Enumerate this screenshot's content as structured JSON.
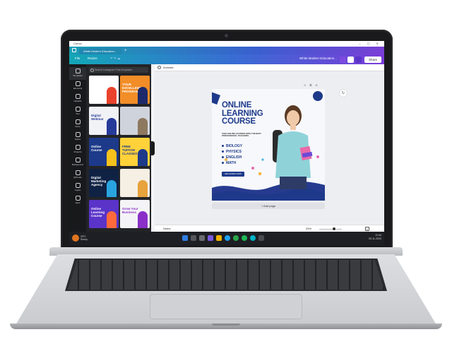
{
  "window": {
    "title": "Canva"
  },
  "tabs": [
    {
      "label": "White Modern Education..."
    }
  ],
  "header": {
    "file_label": "File",
    "resize_label": "Resize",
    "doc_title": "White Modern Education...",
    "share_label": "Share",
    "collaborators": "4"
  },
  "rail": [
    {
      "label": "Templates"
    },
    {
      "label": "Elements"
    },
    {
      "label": "Uploads"
    },
    {
      "label": "Text"
    },
    {
      "label": "Draw"
    },
    {
      "label": "Styles"
    },
    {
      "label": "Projects"
    },
    {
      "label": "Background"
    },
    {
      "label": "QRCode"
    },
    {
      "label": "Logos"
    },
    {
      "label": "Apps"
    }
  ],
  "panel": {
    "search_placeholder": "Search Instagram Post templates",
    "templates": [
      {
        "text": "",
        "bg": "#ffffff",
        "fg": "#1d3a8a",
        "accent": "#e9432c"
      },
      {
        "text": "YOUR EXCELLENT PROGRAM",
        "bg": "#f28d27",
        "fg": "#ffffff",
        "accent": "#1c2a6b"
      },
      {
        "text": "Digital Webinar",
        "bg": "#f1f2f6",
        "fg": "#263a9a",
        "accent": "#263a9a"
      },
      {
        "text": "",
        "bg": "#cfd3dc",
        "fg": "#333333",
        "accent": "#8e7860"
      },
      {
        "text": "Online Course",
        "bg": "#1d3a8a",
        "fg": "#ffffff",
        "accent": "#f7c21c"
      },
      {
        "text": "FREE TUITION CLASSES",
        "bg": "#ffd23a",
        "fg": "#1d3a8a",
        "accent": "#1d3a8a"
      },
      {
        "text": "Digital Marketing Agency",
        "bg": "#0f2244",
        "fg": "#ffffff",
        "accent": "#2aa4e0"
      },
      {
        "text": "",
        "bg": "#f5efe4",
        "fg": "#333333",
        "accent": "#e7a33c"
      },
      {
        "text": "Online Learning Course",
        "bg": "#5a33c9",
        "fg": "#ffffff",
        "accent": "#ff6a3d"
      },
      {
        "text": "Grow Your Business",
        "bg": "#f4f4f6",
        "fg": "#8a30c8",
        "accent": "#8a30c8"
      }
    ]
  },
  "canvas": {
    "animate_label": "Animate",
    "add_page_label": "+ Add page",
    "design": {
      "headline_lines": [
        "ONLINE",
        "LEARNING",
        "COURSE"
      ],
      "subline": "TAKE ONLINE COURSES WITH THE BEST PROFESSIONAL TEACHERS",
      "subjects": [
        "BIOLOGY",
        "PHYSICS",
        "ENGLISH",
        "MATH"
      ],
      "cta": "REGISTER NOW",
      "accent": "#1d3a8a"
    }
  },
  "footer": {
    "notes_label": "Notes",
    "zoom": "33%",
    "page_number": "1"
  },
  "taskbar": {
    "weather": "33°C",
    "weather_desc": "Sunny",
    "time": "11:44",
    "date": "25-11-2023"
  }
}
